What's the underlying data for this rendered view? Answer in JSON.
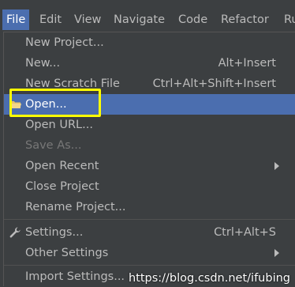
{
  "menubar": {
    "items": [
      {
        "label": "File"
      },
      {
        "label": "Edit"
      },
      {
        "label": "View"
      },
      {
        "label": "Navigate"
      },
      {
        "label": "Code"
      },
      {
        "label": "Refactor"
      },
      {
        "label": "Ru"
      }
    ]
  },
  "file_menu": {
    "items": [
      {
        "label": "New Project...",
        "shortcut": ""
      },
      {
        "label": "New...",
        "shortcut": "Alt+Insert"
      },
      {
        "label": "New Scratch File",
        "shortcut": "Ctrl+Alt+Shift+Insert"
      },
      {
        "label": "Open...",
        "shortcut": ""
      },
      {
        "label": "Open URL...",
        "shortcut": ""
      },
      {
        "label": "Save As...",
        "shortcut": ""
      },
      {
        "label": "Open Recent",
        "shortcut": ""
      },
      {
        "label": "Close Project",
        "shortcut": ""
      },
      {
        "label": "Rename Project...",
        "shortcut": ""
      },
      {
        "label": "Settings...",
        "shortcut": "Ctrl+Alt+S"
      },
      {
        "label": "Other Settings",
        "shortcut": ""
      },
      {
        "label": "Import Settings...",
        "shortcut": ""
      }
    ]
  },
  "watermark": "https://blog.csdn.net/ifubing",
  "colors": {
    "background": "#3c3f41",
    "selection": "#4b6eaf",
    "text": "#bbbbbb",
    "disabled_text": "#777777",
    "highlight_box": "#ffff00"
  }
}
